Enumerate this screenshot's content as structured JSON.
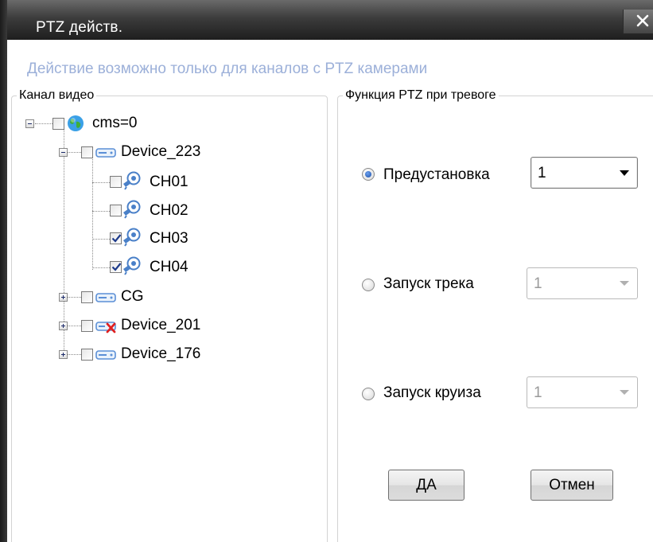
{
  "window": {
    "title": "PTZ действ.",
    "close_label": "✕"
  },
  "notice": "Действие возможно только для каналов с PTZ камерами",
  "channel_group": {
    "legend": "Канал видео",
    "tree": {
      "root": {
        "label": "cms=0",
        "checked": false,
        "icon": "globe-icon",
        "expanded": true
      },
      "device_223": {
        "label": "Device_223",
        "checked": false,
        "icon": "dvr-device-icon",
        "expanded": true,
        "channels": [
          {
            "label": "CH01",
            "checked": false,
            "icon": "ptz-camera-icon"
          },
          {
            "label": "CH02",
            "checked": false,
            "icon": "ptz-camera-icon"
          },
          {
            "label": "CH03",
            "checked": true,
            "icon": "ptz-camera-icon"
          },
          {
            "label": "CH04",
            "checked": true,
            "icon": "ptz-camera-icon"
          }
        ]
      },
      "cg": {
        "label": "CG",
        "checked": false,
        "icon": "dvr-device-icon",
        "expanded": false
      },
      "device_201": {
        "label": "Device_201",
        "checked": false,
        "icon": "dvr-device-offline-icon",
        "expanded": false
      },
      "device_176": {
        "label": "Device_176",
        "checked": false,
        "icon": "dvr-device-icon",
        "expanded": false
      }
    }
  },
  "ptz_group": {
    "legend": "Функция PTZ при тревоге",
    "options": {
      "preset": {
        "label": "Предустановка",
        "selected": true,
        "value": "1",
        "enabled": true
      },
      "track": {
        "label": "Запуск трека",
        "selected": false,
        "value": "1",
        "enabled": false
      },
      "cruise": {
        "label": "Запуск круиза",
        "selected": false,
        "value": "1",
        "enabled": false
      }
    }
  },
  "buttons": {
    "ok": "ДА",
    "cancel": "Отмен"
  },
  "colors": {
    "notice_text": "#9cb0d9",
    "title_bar": "#3c3c3c",
    "radio_selected": "#1d4fa8",
    "checkmark": "#1d3a8a",
    "device_icon": "#5b8fd6",
    "offline_x": "#e02020"
  }
}
